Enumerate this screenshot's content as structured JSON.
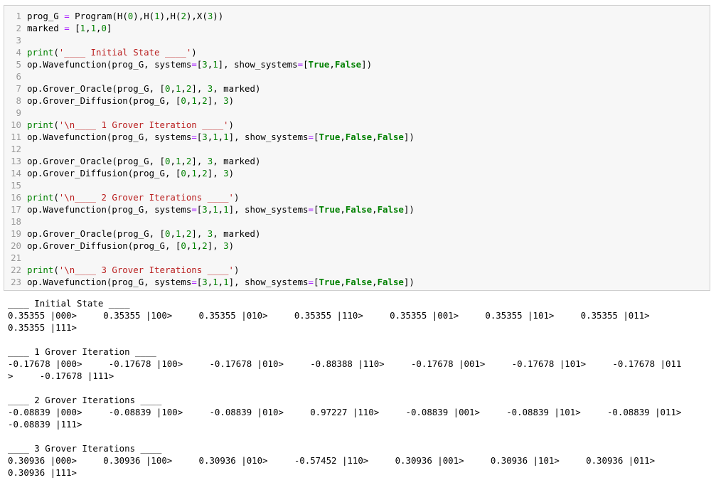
{
  "colors": {
    "keyword_builtin": "#008000",
    "string": "#ba2121",
    "number": "#008000",
    "operator": "#aa22ff",
    "line_number": "#999999",
    "cell_background": "#f7f7f7",
    "cell_border": "#cfcfcf"
  },
  "code_cell": {
    "lines": [
      {
        "number": "1",
        "text": "prog_G = Program(H(0),H(1),H(2),X(3))"
      },
      {
        "number": "2",
        "text": "marked = [1,1,0]"
      },
      {
        "number": "3",
        "text": ""
      },
      {
        "number": "4",
        "text": "print('____ Initial State ____')"
      },
      {
        "number": "5",
        "text": "op.Wavefunction(prog_G, systems=[3,1], show_systems=[True,False])"
      },
      {
        "number": "6",
        "text": ""
      },
      {
        "number": "7",
        "text": "op.Grover_Oracle(prog_G, [0,1,2], 3, marked)"
      },
      {
        "number": "8",
        "text": "op.Grover_Diffusion(prog_G, [0,1,2], 3)"
      },
      {
        "number": "9",
        "text": ""
      },
      {
        "number": "10",
        "text": "print('\\n____ 1 Grover Iteration ____')"
      },
      {
        "number": "11",
        "text": "op.Wavefunction(prog_G, systems=[3,1,1], show_systems=[True,False,False])"
      },
      {
        "number": "12",
        "text": ""
      },
      {
        "number": "13",
        "text": "op.Grover_Oracle(prog_G, [0,1,2], 3, marked)"
      },
      {
        "number": "14",
        "text": "op.Grover_Diffusion(prog_G, [0,1,2], 3)"
      },
      {
        "number": "15",
        "text": ""
      },
      {
        "number": "16",
        "text": "print('\\n____ 2 Grover Iterations ____')"
      },
      {
        "number": "17",
        "text": "op.Wavefunction(prog_G, systems=[3,1,1], show_systems=[True,False,False])"
      },
      {
        "number": "18",
        "text": ""
      },
      {
        "number": "19",
        "text": "op.Grover_Oracle(prog_G, [0,1,2], 3, marked)"
      },
      {
        "number": "20",
        "text": "op.Grover_Diffusion(prog_G, [0,1,2], 3)"
      },
      {
        "number": "21",
        "text": ""
      },
      {
        "number": "22",
        "text": "print('\\n____ 3 Grover Iterations ____')"
      },
      {
        "number": "23",
        "text": "op.Wavefunction(prog_G, systems=[3,1,1], show_systems=[True,False,False])"
      }
    ]
  },
  "output": {
    "lines": [
      "____ Initial State ____",
      "0.35355 |000>     0.35355 |100>     0.35355 |010>     0.35355 |110>     0.35355 |001>     0.35355 |101>     0.35355 |011>",
      "0.35355 |111>",
      "",
      "____ 1 Grover Iteration ____",
      "-0.17678 |000>     -0.17678 |100>     -0.17678 |010>     -0.88388 |110>     -0.17678 |001>     -0.17678 |101>     -0.17678 |011",
      ">     -0.17678 |111>",
      "",
      "____ 2 Grover Iterations ____",
      "-0.08839 |000>     -0.08839 |100>     -0.08839 |010>     0.97227 |110>     -0.08839 |001>     -0.08839 |101>     -0.08839 |011>",
      "-0.08839 |111>",
      "",
      "____ 3 Grover Iterations ____",
      "0.30936 |000>     0.30936 |100>     0.30936 |010>     -0.57452 |110>     0.30936 |001>     0.30936 |101>     0.30936 |011>",
      "0.30936 |111>"
    ]
  }
}
